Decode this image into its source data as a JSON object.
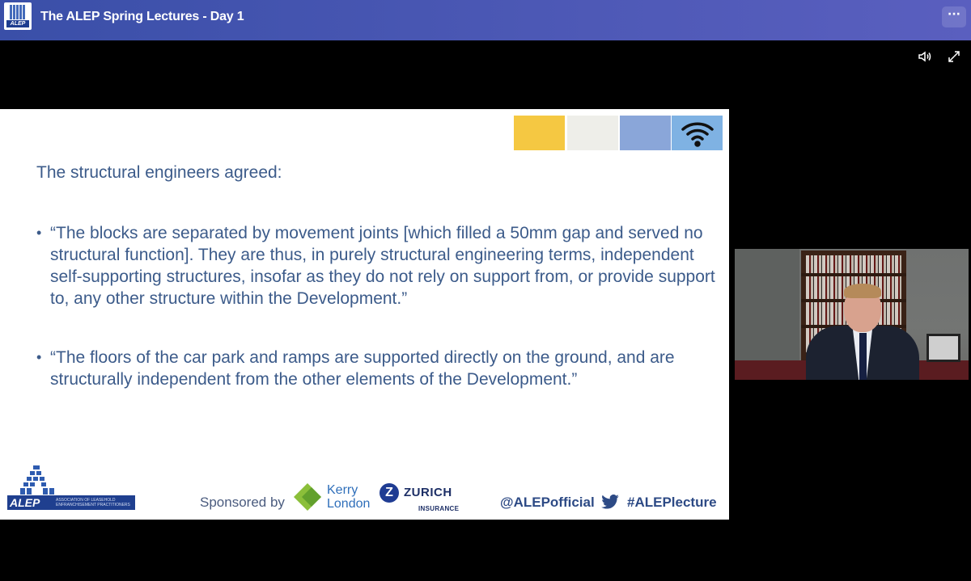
{
  "window": {
    "title": "The ALEP Spring Lectures - Day 1",
    "app_logo_text": "ALEP",
    "more_button": "···"
  },
  "player_controls": {
    "volume_icon": "speaker-icon",
    "expand_icon": "expand-icon"
  },
  "slide": {
    "accent_colors": [
      "#f5c842",
      "#eeeee9",
      "#8aa6d9",
      "#7fb2e3"
    ],
    "heading": "The structural engineers agreed:",
    "bullets": [
      "“The blocks are separated by movement joints [which filled a 50mm gap and served no structural function]. They are thus, in purely structural engineering terms, independent self-supporting structures, insofar as they do not rely on support from, or provide support to, any other structure within the Development.”",
      "“The floors of the car park and ramps are supported directly on the ground, and are structurally independent from the other elements of the Development.”"
    ],
    "footer": {
      "logo_name": "ALEP",
      "logo_subtitle": "ASSOCIATION OF LEASEHOLD ENFRANCHISEMENT PRACTITIONERS",
      "sponsored_label": "Sponsored by",
      "sponsor1_line1": "Kerry",
      "sponsor1_line2": "London",
      "sponsor2_mark": "Z",
      "sponsor2_name": "ZURICH",
      "sponsor2_sub": "INSURANCE",
      "twitter_handle": "@ALEPofficial",
      "hashtag": "#ALEPlecture"
    }
  },
  "speaker_video": {
    "content": "presenter-webcam"
  }
}
